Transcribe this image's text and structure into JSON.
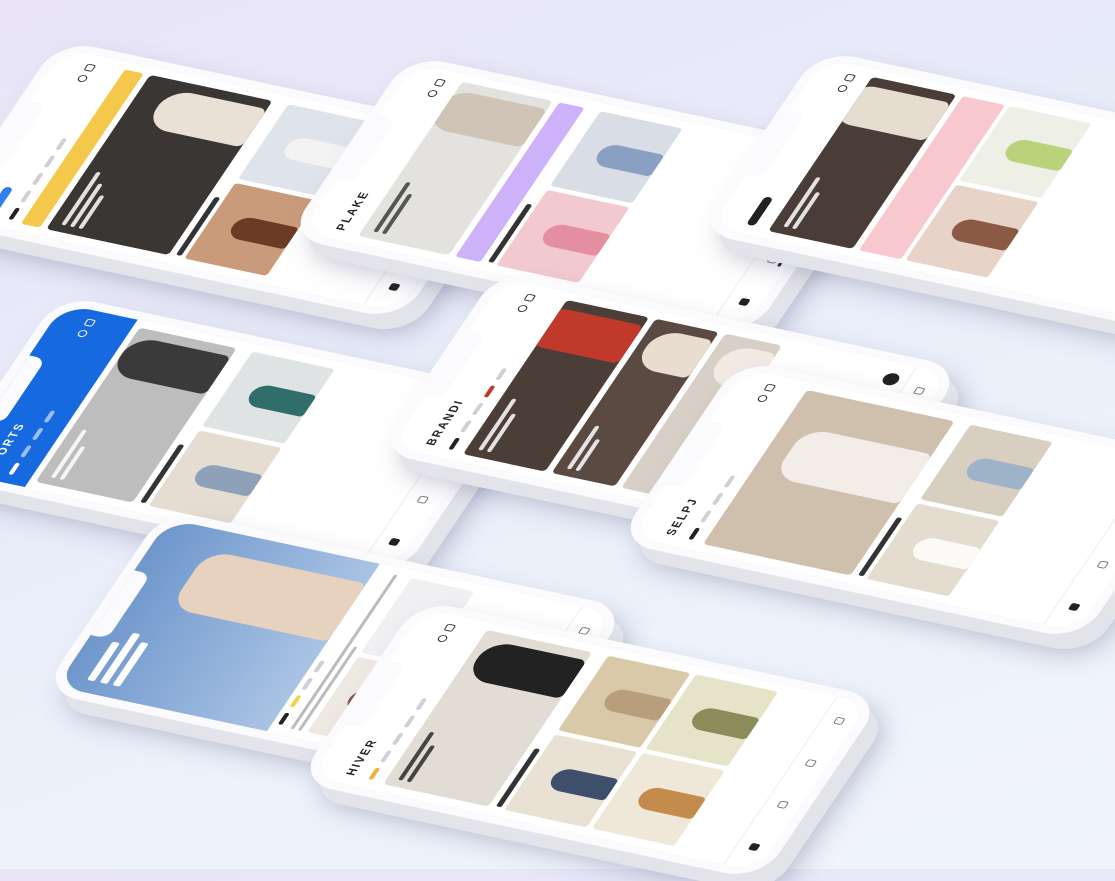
{
  "phones": [
    {
      "id": "p1",
      "brand": "",
      "theme": {
        "hero": "#3a3634",
        "accent": "#2f80ed",
        "strip": "#f4c84a"
      }
    },
    {
      "id": "p2",
      "brand": "PLAKE",
      "theme": {
        "hero": "#e4e2de",
        "accent": "#c6a4f7",
        "strip": "#cdb2fa"
      }
    },
    {
      "id": "p3",
      "brand": "",
      "theme": {
        "hero": "#4a3d38",
        "accent": "#f2b8c1",
        "strip": "#f7c9cf"
      }
    },
    {
      "id": "p4",
      "brand": "SPORTS",
      "theme": {
        "hero": "#bdbdbd",
        "accent": "#1769e0",
        "strip": "#1769e0"
      }
    },
    {
      "id": "p5",
      "brand": "BRANDI",
      "theme": {
        "hero": "#4b3e37",
        "accent": "#c0392b",
        "strip": "#5a4a42"
      }
    },
    {
      "id": "p6",
      "brand": "SELPJ",
      "theme": {
        "hero": "#cfc0ae",
        "accent": "#d8c9b6",
        "strip": "#efe9e1"
      }
    },
    {
      "id": "p7",
      "brand": "",
      "theme": {
        "hero": "#7fa3d1",
        "accent": "#f2d24b",
        "strip": "#e9e9ee"
      }
    },
    {
      "id": "p8",
      "brand": "HIVER",
      "theme": {
        "hero": "#e2ddd4",
        "accent": "#f2b23a",
        "strip": "#d9c9a9"
      }
    }
  ]
}
